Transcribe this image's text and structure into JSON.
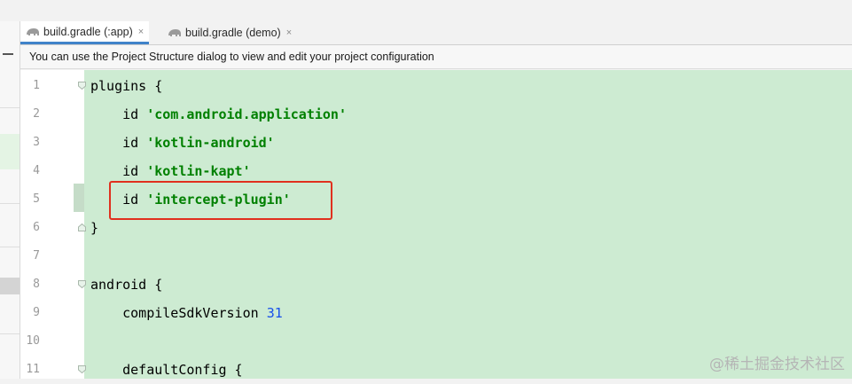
{
  "tabs": [
    {
      "label": "build.gradle (:app)",
      "active": true,
      "icon": "gradle-elephant-icon"
    },
    {
      "label": "build.gradle (demo)",
      "active": false,
      "icon": "gradle-elephant-icon"
    }
  ],
  "tab_close_glyph": "×",
  "banner": {
    "text": "You can use the Project Structure dialog to view and edit your project configuration"
  },
  "code_lines": [
    {
      "n": "1",
      "kw": "plugins {",
      "str": ""
    },
    {
      "n": "2",
      "kw": "    id ",
      "str": "'com.android.application'"
    },
    {
      "n": "3",
      "kw": "    id ",
      "str": "'kotlin-android'"
    },
    {
      "n": "4",
      "kw": "    id ",
      "str": "'kotlin-kapt'"
    },
    {
      "n": "5",
      "kw": "    id ",
      "str": "'intercept-plugin'"
    },
    {
      "n": "6",
      "kw": "}",
      "str": ""
    },
    {
      "n": "7",
      "kw": "",
      "str": ""
    },
    {
      "n": "8",
      "kw": "android {",
      "str": ""
    },
    {
      "n": "9",
      "kw": "    compileSdkVersion ",
      "num": "31"
    },
    {
      "n": "10",
      "kw": "",
      "str": ""
    },
    {
      "n": "11",
      "kw": "    defaultConfig {",
      "str": ""
    }
  ],
  "watermark": "@稀土掘金技术社区",
  "colors": {
    "editor_bg": "#cdebd2",
    "string": "#008000",
    "number": "#1750eb",
    "highlight": "#e0301e",
    "tab_accent": "#4083c9"
  }
}
